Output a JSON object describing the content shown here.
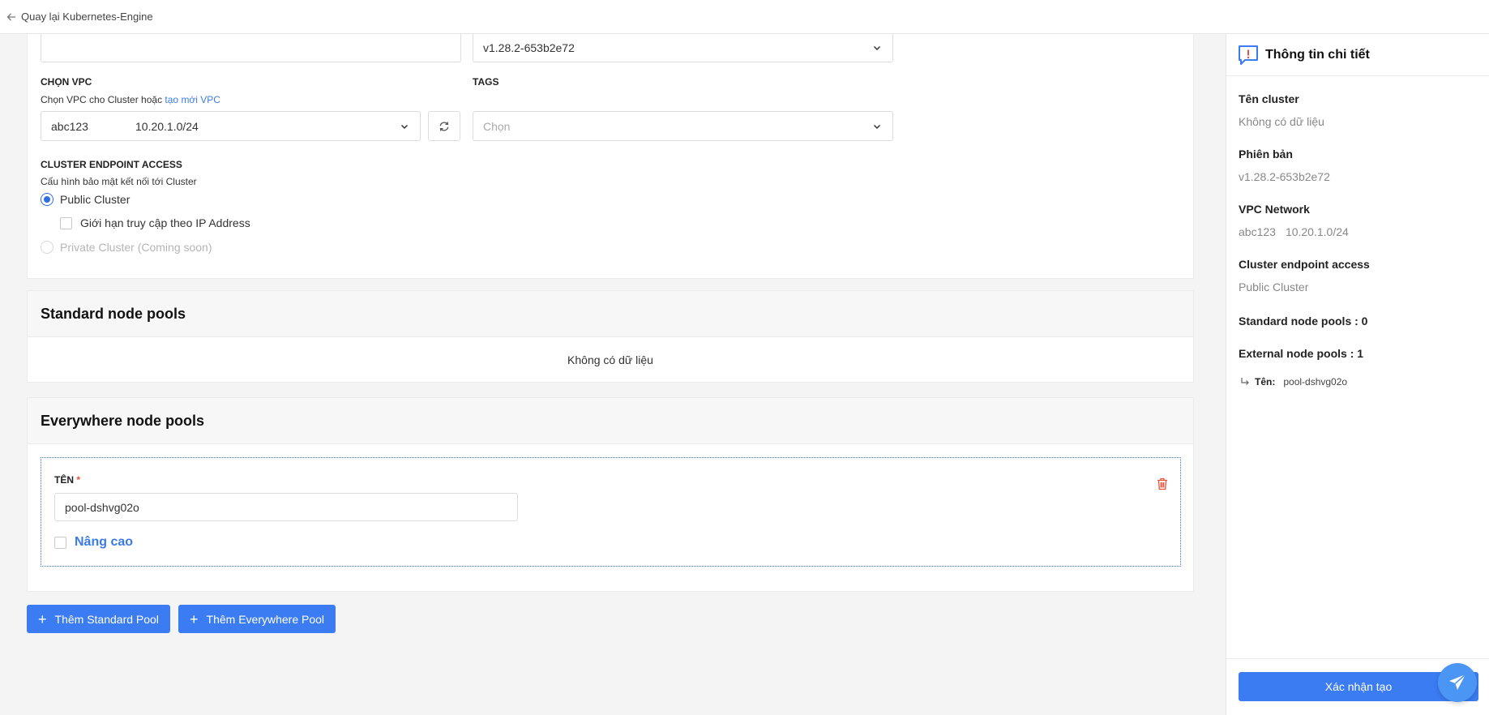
{
  "topbar": {
    "back_label": "Quay lại Kubernetes-Engine"
  },
  "form": {
    "version_value": "v1.28.2-653b2e72",
    "vpc": {
      "label": "CHỌN VPC",
      "help_prefix": "Chọn VPC cho Cluster hoặc ",
      "help_link": "tạo mới VPC",
      "selected_name": "abc123",
      "selected_cidr": "10.20.1.0/24"
    },
    "tags": {
      "label": "TAGS",
      "placeholder": "Chọn"
    },
    "endpoint": {
      "label": "CLUSTER ENDPOINT ACCESS",
      "help": "Cấu hình bảo mật kết nối tới Cluster",
      "public": "Public Cluster",
      "restrict_ip": "Giới hạn truy cập theo IP Address",
      "private": "Private Cluster (Coming soon)"
    }
  },
  "standard_pools": {
    "title": "Standard node pools",
    "empty": "Không có dữ liệu"
  },
  "everywhere_pools": {
    "title": "Everywhere node pools",
    "name_label": "TÊN",
    "required_mark": "*",
    "name_value": "pool-dshvg02o",
    "advanced_label": "Nâng cao"
  },
  "actions": {
    "add_standard": "Thêm Standard Pool",
    "add_everywhere": "Thêm Everywhere Pool"
  },
  "sidebar": {
    "title": "Thông tin chi tiết",
    "cluster_name_label": "Tên cluster",
    "cluster_name_value": "Không có dữ liệu",
    "version_label": "Phiên bản",
    "version_value": "v1.28.2-653b2e72",
    "vpc_label": "VPC Network",
    "vpc_name": "abc123",
    "vpc_cidr": "10.20.1.0/24",
    "endpoint_label": "Cluster endpoint access",
    "endpoint_value": "Public Cluster",
    "standard_pools": "Standard node pools : 0",
    "external_pools": "External node pools : 1",
    "pool_name_label": "Tên:",
    "pool_name_value": "pool-dshvg02o",
    "confirm": "Xác nhận tạo"
  },
  "colors": {
    "accent": "#3b7cf3",
    "danger": "#e5533d"
  }
}
